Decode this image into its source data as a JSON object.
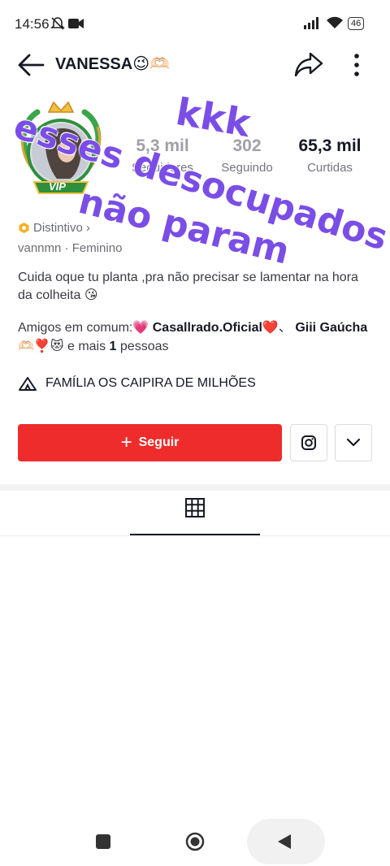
{
  "status_bar": {
    "time": "14:56",
    "battery": "46"
  },
  "header": {
    "title": "VANESSA😉🫶🏻"
  },
  "avatar": {
    "badge": "VIP"
  },
  "stats": [
    {
      "value": "5,3 mil",
      "label": "Seguidores"
    },
    {
      "value": "302",
      "label": "Seguindo"
    },
    {
      "value": "65,3 mil",
      "label": "Curtidas"
    }
  ],
  "profile": {
    "badge_label": "Distintivo",
    "username": "vannmn",
    "gender": "Feminino",
    "bio": "Cuida oque tu  planta ,pra não precisar se lamentar na hora da colheita 😘",
    "friends_prefix": "Amigos em comum:💗",
    "friend1": "Casallrado.Oficial",
    "friend1_suffix": "❤️、",
    "friend2": "Giii Gaúcha",
    "friends_emoji": "🫶🏻❣️😻",
    "friends_more_prefix": " e mais ",
    "friends_more_count": "1",
    "friends_more_suffix": " pessoas",
    "group": "FAMÍLIA OS CAIPIRA DE  MILHÕES"
  },
  "actions": {
    "follow_label": "Seguir"
  },
  "overlay_text": {
    "line1": "kkk",
    "line2": "esses desocupados",
    "line3": "não param"
  },
  "colors": {
    "follow": "#ee2c2c",
    "overlay": "#7a4ee6"
  }
}
